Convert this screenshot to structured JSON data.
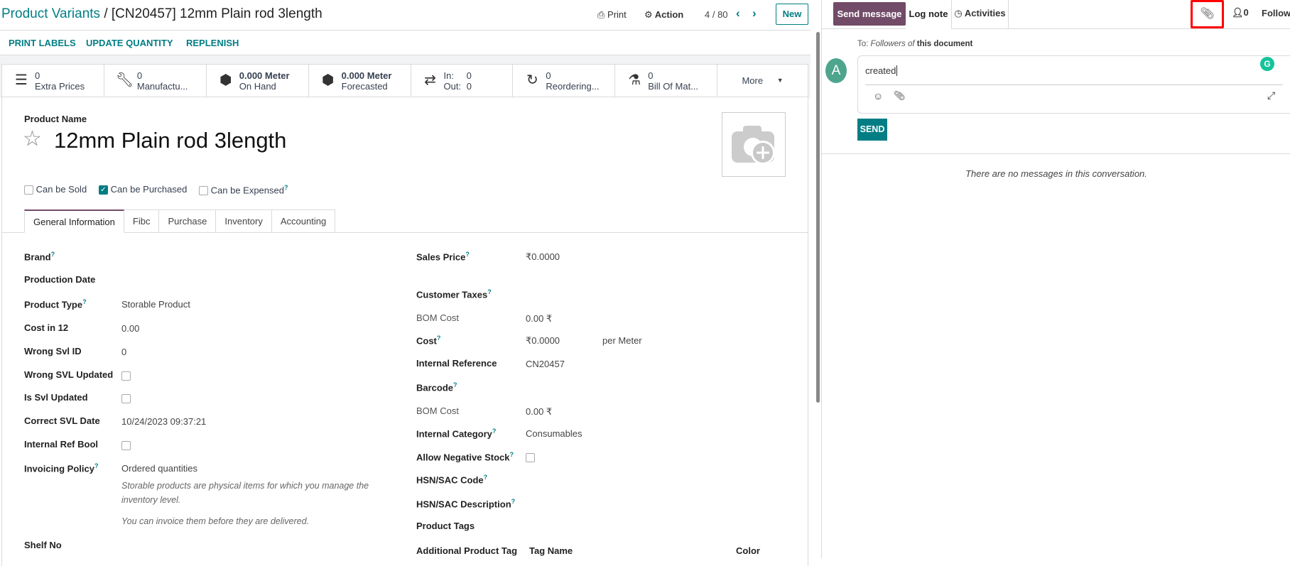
{
  "header": {
    "breadcrumb_parent": "Product Variants",
    "breadcrumb_sep": " / ",
    "breadcrumb_current": "[CN20457] 12mm Plain rod 3length",
    "print": "Print",
    "action": "Action",
    "pager": "4 / 80",
    "new": "New"
  },
  "actions": [
    "PRINT LABELS",
    "UPDATE QUANTITY",
    "REPLENISH"
  ],
  "stats": [
    {
      "icon": "list-icon",
      "value": "0",
      "label": "Extra Prices"
    },
    {
      "icon": "wrench-icon",
      "value": "0",
      "label": "Manufactu..."
    },
    {
      "icon": "cubes-icon",
      "value": "0.000 Meter",
      "label": "On Hand"
    },
    {
      "icon": "cubes-icon",
      "value": "0.000 Meter",
      "label": "Forecasted"
    },
    {
      "icon": "exchange-icon",
      "in_label": "In:",
      "in_value": "0",
      "out_label": "Out:",
      "out_value": "0"
    },
    {
      "icon": "refresh-icon",
      "value": "0",
      "label": "Reordering..."
    },
    {
      "icon": "flask-icon",
      "value": "0",
      "label": "Bill Of Mat..."
    },
    {
      "label": "More"
    }
  ],
  "product": {
    "name_label": "Product Name",
    "name": "12mm Plain rod 3length",
    "flags": [
      {
        "label": "Can be Sold",
        "checked": false
      },
      {
        "label": "Can be Purchased",
        "checked": true
      },
      {
        "label": "Can be Expensed",
        "checked": false,
        "help": "?"
      }
    ]
  },
  "tabs": [
    "General Information",
    "Fibc",
    "Purchase",
    "Inventory",
    "Accounting"
  ],
  "left_fields": [
    {
      "label": "Brand",
      "help": "?",
      "value": ""
    },
    {
      "label": "Production Date",
      "value": ""
    },
    {
      "label": "Product Type",
      "help": "?",
      "value": "Storable Product"
    },
    {
      "label": "Cost in 12",
      "value": "0.00"
    },
    {
      "label": "Wrong Svl ID",
      "value": "0"
    },
    {
      "label": "Wrong SVL Updated",
      "checkbox": false
    },
    {
      "label": "Is Svl Updated",
      "checkbox": false
    },
    {
      "label": "Correct SVL Date",
      "value": "10/24/2023 09:37:21"
    },
    {
      "label": "Internal Ref Bool",
      "checkbox": false
    },
    {
      "label": "Invoicing Policy",
      "help": "?",
      "value": "Ordered quantities"
    },
    {
      "label": "Shelf No",
      "value": ""
    }
  ],
  "notes": [
    "Storable products are physical items for which you manage the",
    "inventory level.",
    "You can invoice them before they are delivered."
  ],
  "right_fields": [
    {
      "label": "Sales Price",
      "help": "?",
      "value": "₹0.0000"
    },
    {
      "label": "Customer Taxes",
      "help": "?",
      "value": ""
    },
    {
      "label": "BOM Cost",
      "value": "0.00 ₹",
      "muted": true
    },
    {
      "label": "Cost",
      "help": "?",
      "value": "₹0.0000",
      "unit": "per Meter"
    },
    {
      "label": "Internal Reference",
      "value": "CN20457"
    },
    {
      "label": "Barcode",
      "help": "?",
      "value": ""
    },
    {
      "label": "BOM Cost",
      "value": "0.00 ₹",
      "muted": true
    },
    {
      "label": "Internal Category",
      "help": "?",
      "value": "Consumables"
    },
    {
      "label": "Allow Negative Stock",
      "help": "?",
      "checkbox": false
    },
    {
      "label": "HSN/SAC Code",
      "help": "?",
      "value": ""
    },
    {
      "label": "HSN/SAC Description",
      "help": "?",
      "value": ""
    },
    {
      "label": "Product Tags",
      "value": ""
    },
    {
      "label": "Additional Product Tag",
      "value": ""
    }
  ],
  "tag_table": {
    "col1": "Tag Name",
    "col2": "Color"
  },
  "chatter": {
    "send_message": "Send message",
    "log_note": "Log note",
    "activities": "Activities",
    "followers_count": "0",
    "follow": "Follow",
    "to_prefix": "To:",
    "to_followers": "Followers of",
    "to_doc": "this document",
    "avatar": "A",
    "composer_value": "created",
    "send": "SEND",
    "empty": "There are no messages in this conversation."
  },
  "colors": {
    "brand": "#714b67",
    "accent": "#017e84",
    "highlight": "#ff0000",
    "avatar": "#4ea58d"
  }
}
